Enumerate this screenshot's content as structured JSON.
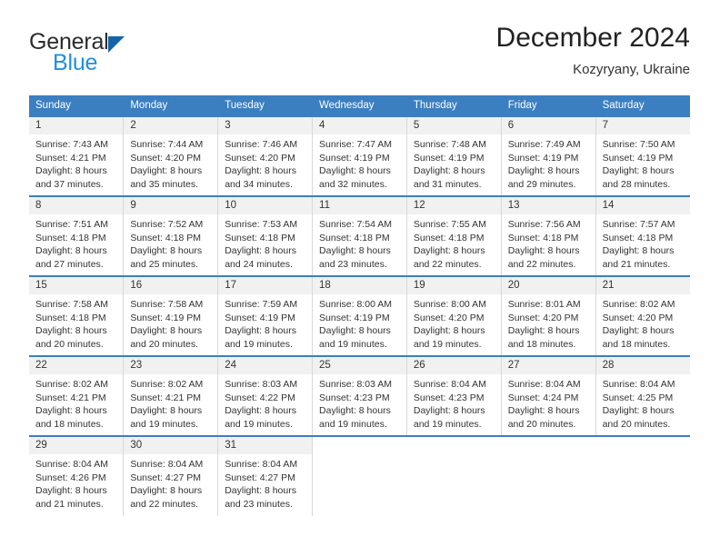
{
  "brand": {
    "name_top": "General",
    "name_bottom": "Blue",
    "accent_color": "#1f8fe0",
    "triangle_color": "#1464aa"
  },
  "header": {
    "title": "December 2024",
    "subtitle": "Kozyryany, Ukraine"
  },
  "calendar": {
    "header_bg": "#3c7fc0",
    "daynum_bg": "#f1f1f1",
    "weekdays": [
      "Sunday",
      "Monday",
      "Tuesday",
      "Wednesday",
      "Thursday",
      "Friday",
      "Saturday"
    ],
    "weeks": [
      [
        {
          "day": "1",
          "sunrise": "Sunrise: 7:43 AM",
          "sunset": "Sunset: 4:21 PM",
          "daylight1": "Daylight: 8 hours",
          "daylight2": "and 37 minutes."
        },
        {
          "day": "2",
          "sunrise": "Sunrise: 7:44 AM",
          "sunset": "Sunset: 4:20 PM",
          "daylight1": "Daylight: 8 hours",
          "daylight2": "and 35 minutes."
        },
        {
          "day": "3",
          "sunrise": "Sunrise: 7:46 AM",
          "sunset": "Sunset: 4:20 PM",
          "daylight1": "Daylight: 8 hours",
          "daylight2": "and 34 minutes."
        },
        {
          "day": "4",
          "sunrise": "Sunrise: 7:47 AM",
          "sunset": "Sunset: 4:19 PM",
          "daylight1": "Daylight: 8 hours",
          "daylight2": "and 32 minutes."
        },
        {
          "day": "5",
          "sunrise": "Sunrise: 7:48 AM",
          "sunset": "Sunset: 4:19 PM",
          "daylight1": "Daylight: 8 hours",
          "daylight2": "and 31 minutes."
        },
        {
          "day": "6",
          "sunrise": "Sunrise: 7:49 AM",
          "sunset": "Sunset: 4:19 PM",
          "daylight1": "Daylight: 8 hours",
          "daylight2": "and 29 minutes."
        },
        {
          "day": "7",
          "sunrise": "Sunrise: 7:50 AM",
          "sunset": "Sunset: 4:19 PM",
          "daylight1": "Daylight: 8 hours",
          "daylight2": "and 28 minutes."
        }
      ],
      [
        {
          "day": "8",
          "sunrise": "Sunrise: 7:51 AM",
          "sunset": "Sunset: 4:18 PM",
          "daylight1": "Daylight: 8 hours",
          "daylight2": "and 27 minutes."
        },
        {
          "day": "9",
          "sunrise": "Sunrise: 7:52 AM",
          "sunset": "Sunset: 4:18 PM",
          "daylight1": "Daylight: 8 hours",
          "daylight2": "and 25 minutes."
        },
        {
          "day": "10",
          "sunrise": "Sunrise: 7:53 AM",
          "sunset": "Sunset: 4:18 PM",
          "daylight1": "Daylight: 8 hours",
          "daylight2": "and 24 minutes."
        },
        {
          "day": "11",
          "sunrise": "Sunrise: 7:54 AM",
          "sunset": "Sunset: 4:18 PM",
          "daylight1": "Daylight: 8 hours",
          "daylight2": "and 23 minutes."
        },
        {
          "day": "12",
          "sunrise": "Sunrise: 7:55 AM",
          "sunset": "Sunset: 4:18 PM",
          "daylight1": "Daylight: 8 hours",
          "daylight2": "and 22 minutes."
        },
        {
          "day": "13",
          "sunrise": "Sunrise: 7:56 AM",
          "sunset": "Sunset: 4:18 PM",
          "daylight1": "Daylight: 8 hours",
          "daylight2": "and 22 minutes."
        },
        {
          "day": "14",
          "sunrise": "Sunrise: 7:57 AM",
          "sunset": "Sunset: 4:18 PM",
          "daylight1": "Daylight: 8 hours",
          "daylight2": "and 21 minutes."
        }
      ],
      [
        {
          "day": "15",
          "sunrise": "Sunrise: 7:58 AM",
          "sunset": "Sunset: 4:18 PM",
          "daylight1": "Daylight: 8 hours",
          "daylight2": "and 20 minutes."
        },
        {
          "day": "16",
          "sunrise": "Sunrise: 7:58 AM",
          "sunset": "Sunset: 4:19 PM",
          "daylight1": "Daylight: 8 hours",
          "daylight2": "and 20 minutes."
        },
        {
          "day": "17",
          "sunrise": "Sunrise: 7:59 AM",
          "sunset": "Sunset: 4:19 PM",
          "daylight1": "Daylight: 8 hours",
          "daylight2": "and 19 minutes."
        },
        {
          "day": "18",
          "sunrise": "Sunrise: 8:00 AM",
          "sunset": "Sunset: 4:19 PM",
          "daylight1": "Daylight: 8 hours",
          "daylight2": "and 19 minutes."
        },
        {
          "day": "19",
          "sunrise": "Sunrise: 8:00 AM",
          "sunset": "Sunset: 4:20 PM",
          "daylight1": "Daylight: 8 hours",
          "daylight2": "and 19 minutes."
        },
        {
          "day": "20",
          "sunrise": "Sunrise: 8:01 AM",
          "sunset": "Sunset: 4:20 PM",
          "daylight1": "Daylight: 8 hours",
          "daylight2": "and 18 minutes."
        },
        {
          "day": "21",
          "sunrise": "Sunrise: 8:02 AM",
          "sunset": "Sunset: 4:20 PM",
          "daylight1": "Daylight: 8 hours",
          "daylight2": "and 18 minutes."
        }
      ],
      [
        {
          "day": "22",
          "sunrise": "Sunrise: 8:02 AM",
          "sunset": "Sunset: 4:21 PM",
          "daylight1": "Daylight: 8 hours",
          "daylight2": "and 18 minutes."
        },
        {
          "day": "23",
          "sunrise": "Sunrise: 8:02 AM",
          "sunset": "Sunset: 4:21 PM",
          "daylight1": "Daylight: 8 hours",
          "daylight2": "and 19 minutes."
        },
        {
          "day": "24",
          "sunrise": "Sunrise: 8:03 AM",
          "sunset": "Sunset: 4:22 PM",
          "daylight1": "Daylight: 8 hours",
          "daylight2": "and 19 minutes."
        },
        {
          "day": "25",
          "sunrise": "Sunrise: 8:03 AM",
          "sunset": "Sunset: 4:23 PM",
          "daylight1": "Daylight: 8 hours",
          "daylight2": "and 19 minutes."
        },
        {
          "day": "26",
          "sunrise": "Sunrise: 8:04 AM",
          "sunset": "Sunset: 4:23 PM",
          "daylight1": "Daylight: 8 hours",
          "daylight2": "and 19 minutes."
        },
        {
          "day": "27",
          "sunrise": "Sunrise: 8:04 AM",
          "sunset": "Sunset: 4:24 PM",
          "daylight1": "Daylight: 8 hours",
          "daylight2": "and 20 minutes."
        },
        {
          "day": "28",
          "sunrise": "Sunrise: 8:04 AM",
          "sunset": "Sunset: 4:25 PM",
          "daylight1": "Daylight: 8 hours",
          "daylight2": "and 20 minutes."
        }
      ],
      [
        {
          "day": "29",
          "sunrise": "Sunrise: 8:04 AM",
          "sunset": "Sunset: 4:26 PM",
          "daylight1": "Daylight: 8 hours",
          "daylight2": "and 21 minutes."
        },
        {
          "day": "30",
          "sunrise": "Sunrise: 8:04 AM",
          "sunset": "Sunset: 4:27 PM",
          "daylight1": "Daylight: 8 hours",
          "daylight2": "and 22 minutes."
        },
        {
          "day": "31",
          "sunrise": "Sunrise: 8:04 AM",
          "sunset": "Sunset: 4:27 PM",
          "daylight1": "Daylight: 8 hours",
          "daylight2": "and 23 minutes."
        },
        {
          "day": "",
          "sunrise": "",
          "sunset": "",
          "daylight1": "",
          "daylight2": ""
        },
        {
          "day": "",
          "sunrise": "",
          "sunset": "",
          "daylight1": "",
          "daylight2": ""
        },
        {
          "day": "",
          "sunrise": "",
          "sunset": "",
          "daylight1": "",
          "daylight2": ""
        },
        {
          "day": "",
          "sunrise": "",
          "sunset": "",
          "daylight1": "",
          "daylight2": ""
        }
      ]
    ]
  }
}
